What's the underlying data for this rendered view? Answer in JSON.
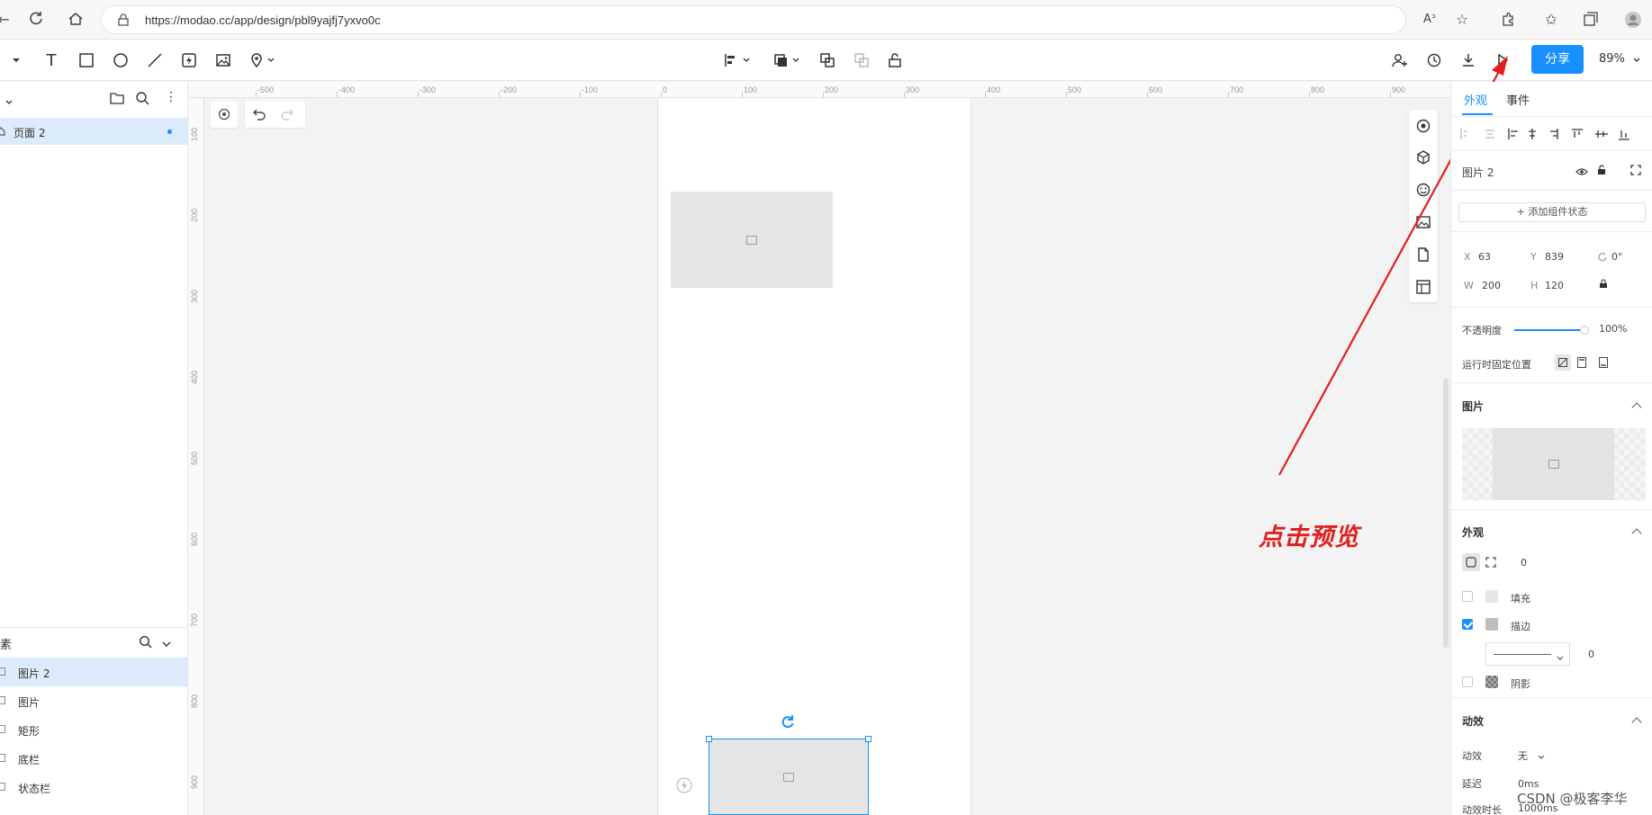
{
  "browser": {
    "url": "https://modao.cc/app/design/pbl9yajfj7yxvo0c"
  },
  "toolbar": {
    "share_label": "分享",
    "zoom_label": "89%"
  },
  "left_panel": {
    "page_item": "页面 2",
    "layers_title": "素",
    "layers": [
      {
        "label": "图片 2",
        "selected": true
      },
      {
        "label": "图片",
        "selected": false
      },
      {
        "label": "矩形",
        "selected": false
      },
      {
        "label": "底栏",
        "selected": false
      },
      {
        "label": "状态栏",
        "selected": false
      }
    ]
  },
  "ruler": {
    "top_labels": [
      "-500",
      "-400",
      "-300",
      "-200",
      "-100",
      "0",
      "100",
      "200",
      "300",
      "400",
      "500",
      "600",
      "700",
      "800",
      "900"
    ],
    "left_labels": [
      "100",
      "200",
      "300",
      "400",
      "500",
      "600",
      "700",
      "800",
      "900"
    ]
  },
  "right_panel": {
    "tabs": [
      "外观",
      "事件"
    ],
    "component_name": "图片 2",
    "add_state_label": "+ 添加组件状态",
    "x_label": "X",
    "x_value": "63",
    "y_label": "Y",
    "y_value": "839",
    "rotation_value": "0°",
    "w_label": "W",
    "w_value": "200",
    "h_label": "H",
    "h_value": "120",
    "opacity_label": "不透明度",
    "opacity_value": "100%",
    "fixed_position_label": "运行时固定位置",
    "image_heading": "图片",
    "appearance_heading": "外观",
    "corner_value": "0",
    "fill_label": "填充",
    "stroke_label": "描边",
    "stroke_width": "0",
    "shadow_label": "阴影",
    "animation_heading": "动效",
    "anim_label": "动效",
    "anim_value": "无",
    "delay_label": "延迟",
    "delay_value": "0ms",
    "duration_label": "动效时长",
    "duration_value": "1000ms"
  },
  "annotation": {
    "text": "点击预览",
    "color": "#e21f1f"
  },
  "watermark": "CSDN @极客李华",
  "colors": {
    "accent": "#1890ff",
    "selection_bg": "#dcebfb"
  }
}
